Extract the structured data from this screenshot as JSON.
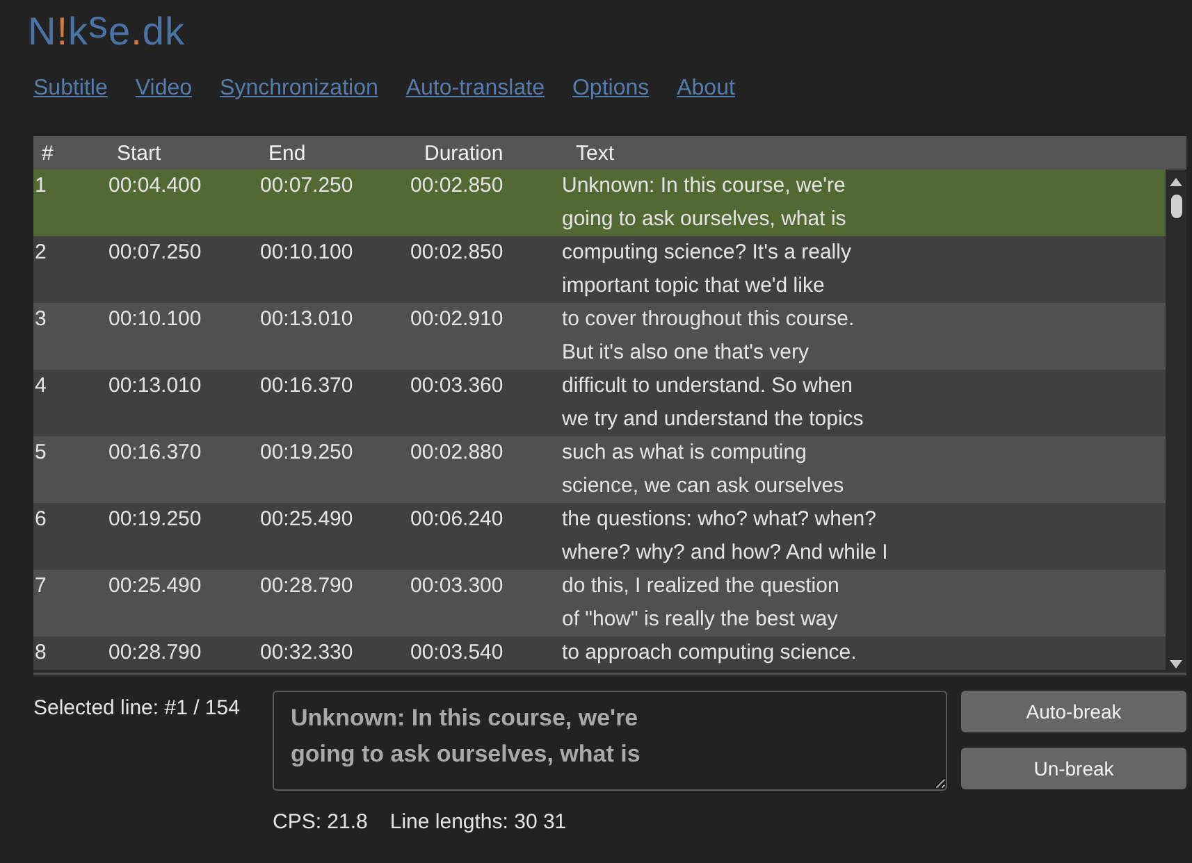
{
  "logo": [
    {
      "text": "N",
      "kind": "plain"
    },
    {
      "text": "!",
      "kind": "accent"
    },
    {
      "text": "k",
      "kind": "plain"
    },
    {
      "text": "s",
      "kind": "raised"
    },
    {
      "text": "e",
      "kind": "plain"
    },
    {
      "text": ".",
      "kind": "accent"
    },
    {
      "text": "dk",
      "kind": "plain"
    }
  ],
  "nav": [
    {
      "label": "Subtitle"
    },
    {
      "label": "Video"
    },
    {
      "label": "Synchronization"
    },
    {
      "label": "Auto-translate"
    },
    {
      "label": "Options"
    },
    {
      "label": "About"
    }
  ],
  "table": {
    "columns": [
      "#",
      "Start",
      "End",
      "Duration",
      "Text"
    ],
    "rows": [
      {
        "number": "1",
        "start": "00:04.400",
        "end": "00:07.250",
        "duration": "00:02.850",
        "text": "Unknown: In this course, we're\ngoing to ask ourselves, what is",
        "selected": true
      },
      {
        "number": "2",
        "start": "00:07.250",
        "end": "00:10.100",
        "duration": "00:02.850",
        "text": "computing science? It's a really\nimportant topic that we'd like",
        "selected": false
      },
      {
        "number": "3",
        "start": "00:10.100",
        "end": "00:13.010",
        "duration": "00:02.910",
        "text": "to cover throughout this course.\nBut it's also one that's very",
        "selected": false
      },
      {
        "number": "4",
        "start": "00:13.010",
        "end": "00:16.370",
        "duration": "00:03.360",
        "text": "difficult to understand. So when\nwe try and understand the topics",
        "selected": false
      },
      {
        "number": "5",
        "start": "00:16.370",
        "end": "00:19.250",
        "duration": "00:02.880",
        "text": "such as what is computing\nscience, we can ask ourselves",
        "selected": false
      },
      {
        "number": "6",
        "start": "00:19.250",
        "end": "00:25.490",
        "duration": "00:06.240",
        "text": "the questions: who? what? when?\nwhere? why? and how? And while I",
        "selected": false
      },
      {
        "number": "7",
        "start": "00:25.490",
        "end": "00:28.790",
        "duration": "00:03.300",
        "text": "do this, I realized the question\nof \"how\" is really the best way",
        "selected": false
      },
      {
        "number": "8",
        "start": "00:28.790",
        "end": "00:32.330",
        "duration": "00:03.540",
        "text": "to approach computing science.",
        "selected": false
      }
    ]
  },
  "editor": {
    "selected_line": "Selected line: #1 / 154",
    "value": "Unknown: In this course, we're\ngoing to ask ourselves, what is",
    "cps": "CPS: 21.8",
    "line_lengths": "Line lengths: 30 31",
    "buttons": [
      "Auto-break",
      "Un-break"
    ]
  }
}
